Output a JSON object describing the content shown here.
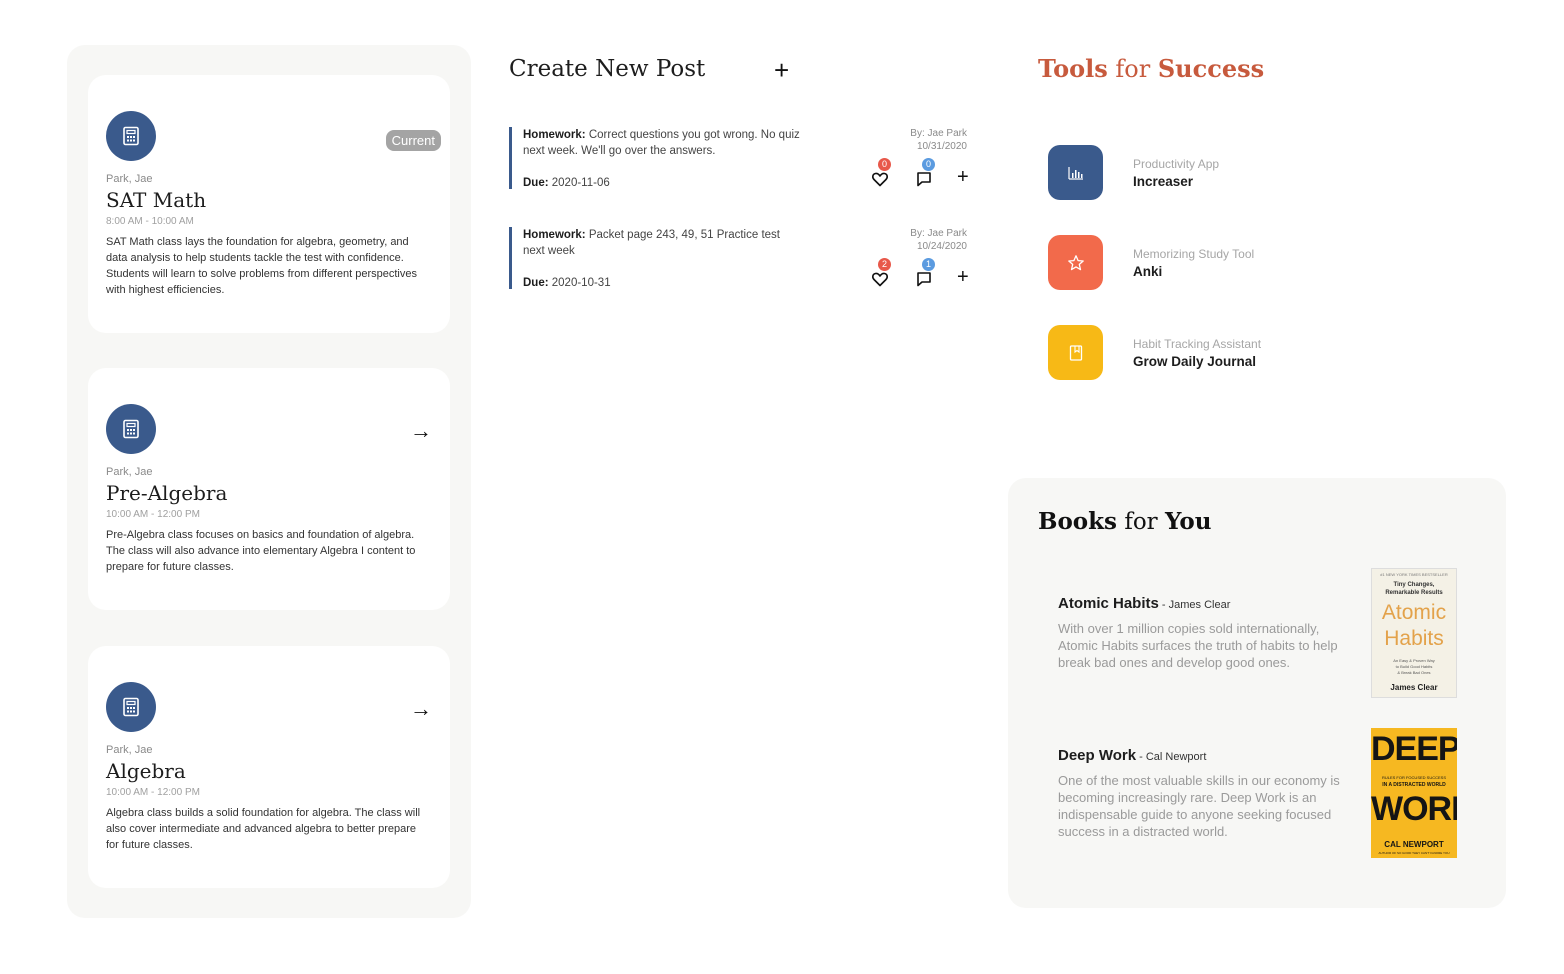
{
  "classes": [
    {
      "teacher": "Park, Jae",
      "title": "SAT Math",
      "time": "8:00 AM - 10:00 AM",
      "description": "SAT Math class lays the foundation for algebra, geometry, and data analysis to help students tackle the test with confidence. Students will learn to solve problems from different perspectives with highest efficiencies.",
      "badge": "Current"
    },
    {
      "teacher": "Park, Jae",
      "title": "Pre-Algebra",
      "time": "10:00 AM - 12:00 PM",
      "description": "Pre-Algebra class focuses on basics and foundation of algebra. The class will also advance into elementary Algebra I content to prepare for future classes.",
      "arrow": "→"
    },
    {
      "teacher": "Park, Jae",
      "title": "Algebra",
      "time": "10:00 AM - 12:00 PM",
      "description": "Algebra class builds a solid foundation for algebra. The class will also cover intermediate and advanced algebra to better prepare for future classes.",
      "arrow": "→"
    }
  ],
  "feed": {
    "create_title": "Create New Post",
    "create_icon": "plus-icon",
    "posts": [
      {
        "type_label": "Homework:",
        "text": "Correct questions you got wrong. No quiz next week. We'll go over the answers.",
        "due_label": "Due:",
        "due": "2020-11-06",
        "author": "By: Jae Park",
        "date": "10/31/2020",
        "likes": "0",
        "comments": "0"
      },
      {
        "type_label": "Homework:",
        "text": "Packet page 243, 49, 51 Practice test next week",
        "due_label": "Due:",
        "due": "2020-10-31",
        "author": "By: Jae Park",
        "date": "10/24/2020",
        "likes": "2",
        "comments": "1"
      }
    ]
  },
  "tools": {
    "title_part1": "Tools",
    "title_part2": " for ",
    "title_part3": "Success",
    "items": [
      {
        "category": "Productivity App",
        "name": "Increaser",
        "color": "#3a5a8c",
        "icon": "bar-chart-icon"
      },
      {
        "category": "Memorizing Study Tool",
        "name": "Anki",
        "color": "#f26a4b",
        "icon": "star-icon"
      },
      {
        "category": "Habit Tracking Assistant",
        "name": "Grow Daily Journal",
        "color": "#f7b916",
        "icon": "journal-icon"
      }
    ]
  },
  "books": {
    "title_part1": "Books",
    "title_part2": " for ",
    "title_part3": "You",
    "items": [
      {
        "title": "Atomic Habits",
        "author": " - James Clear",
        "description": "With over 1 million copies sold internationally, Atomic Habits surfaces the truth of habits to help break bad ones and develop good ones.",
        "cover": {
          "top": "#1 NEW YORK TIMES BESTSELLER",
          "sub1": "Tiny Changes,",
          "sub2": "Remarkable Results",
          "word1": "Atomic",
          "word2": "Habits",
          "tagline1": "An Easy & Proven Way",
          "tagline2": "to Build Good Habits",
          "tagline3": "& Break Bad Ones",
          "author": "James Clear"
        }
      },
      {
        "title": "Deep Work",
        "author": " - Cal Newport",
        "description": "One of the most valuable skills in our economy is becoming increasingly rare. Deep Work is an indispensable guide to anyone seeking focused success in a distracted world.",
        "cover": {
          "word1": "DEEP",
          "mid1": "RULES FOR FOCUSED SUCCESS",
          "mid2": "IN A DISTRACTED WORLD",
          "word2": "WORK",
          "author": "CAL NEWPORT",
          "footer": "AUTHOR OF SO GOOD THEY CAN'T IGNORE YOU"
        }
      }
    ]
  },
  "colors": {
    "accent_blue": "#3a5a8c",
    "accent_orange": "#c75a3d",
    "badge_red": "#e8584a",
    "badge_blue": "#5b9be0"
  }
}
